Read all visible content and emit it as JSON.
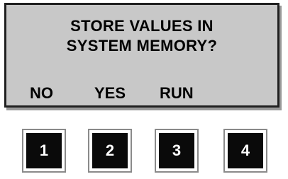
{
  "display": {
    "prompt_line1": "STORE VALUES IN",
    "prompt_line2": "SYSTEM MEMORY?",
    "softkeys": [
      "NO",
      "YES",
      "RUN",
      ""
    ]
  },
  "keypad": {
    "buttons": [
      "1",
      "2",
      "3",
      "4"
    ]
  },
  "colors": {
    "screen_background": "#c8c8c8",
    "screen_border": "#202020",
    "key_face": "#0a0a0a",
    "key_text": "#ffffff"
  }
}
